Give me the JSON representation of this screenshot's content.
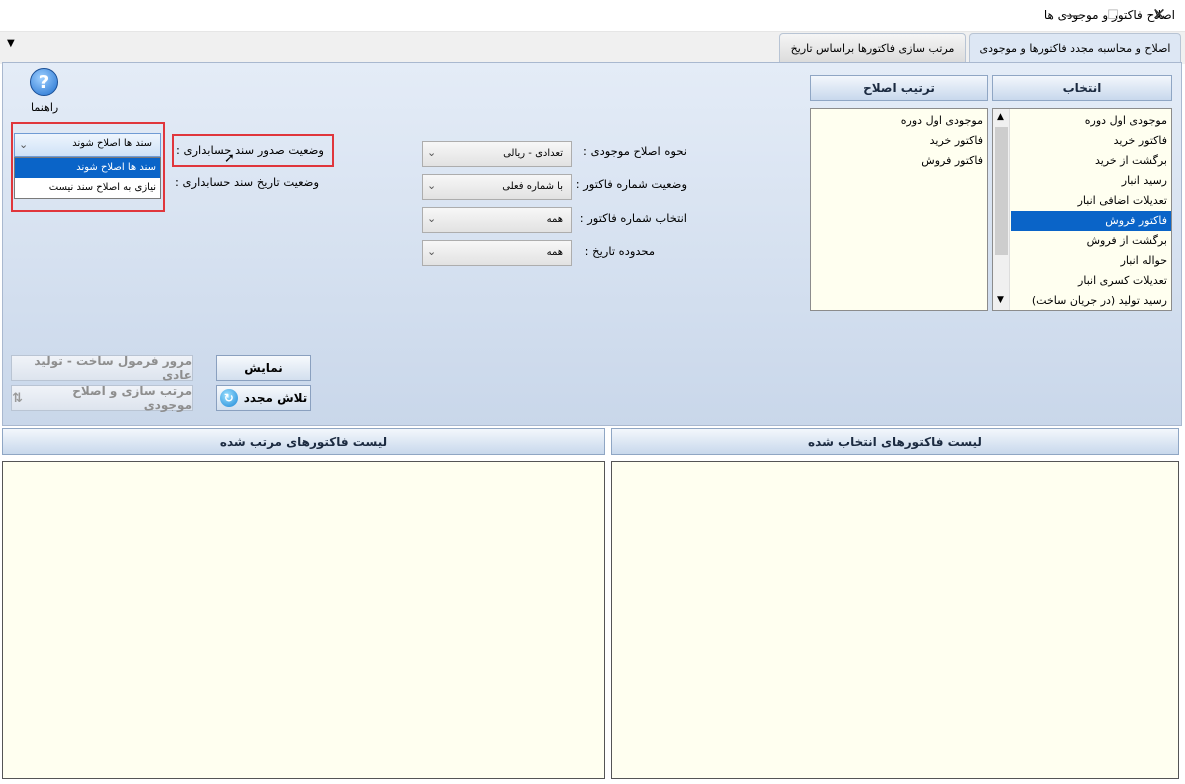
{
  "window": {
    "title": "اصلاح فاکتور و موجودی ها",
    "minimize_icon": "minimize-icon",
    "maximize_icon": "maximize-icon",
    "close_icon": "close-icon"
  },
  "tabs": [
    {
      "label": "اصلاح و محاسبه مجدد فاکتورها و موجودی",
      "active": true
    },
    {
      "label": "مرتب سازی فاکتورها براساس تاریخ",
      "active": false
    }
  ],
  "help": {
    "label": "راهنما"
  },
  "selection": {
    "header": "انتخاب",
    "items": [
      "موجودی اول دوره",
      "فاکتور خرید",
      "برگشت از خرید",
      "رسید انبار",
      "تعدیلات اضافی انبار",
      "فاکتور فروش",
      "برگشت از فروش",
      "حواله انبار",
      "تعدیلات کسری انبار",
      "رسید تولید (در جریان ساخت)"
    ],
    "selected": "فاکتور فروش"
  },
  "order": {
    "header": "ترتیب اصلاح",
    "items": [
      "موجودی اول دوره",
      "فاکتور خرید",
      "فاکتور فروش"
    ]
  },
  "fields": {
    "inventory_method": {
      "label": "نحوه اصلاح موجودی :",
      "value": "تعدادی - ریالی"
    },
    "invoice_number_status": {
      "label": "وضعیت شماره فاکتور :",
      "value": "با شماره فعلی"
    },
    "invoice_number_select": {
      "label": "انتخاب شماره فاکتور :",
      "value": "همه"
    },
    "date_range": {
      "label": "محدوده تاریخ :",
      "value": "همه"
    },
    "doc_issue_status": {
      "label": "وضعیت صدور سند حسابداری :",
      "value": "سند ها اصلاح شوند"
    },
    "doc_date_status": {
      "label": "وضعیت تاریخ سند حسابداری :"
    }
  },
  "dropdown_options": [
    "سند ها اصلاح شوند",
    "نیازی به اصلاح سند نیست"
  ],
  "buttons": {
    "show": "نمایش",
    "retry": "تلاش مجدد",
    "formula_review": "مرور فرمول ساخت - تولید عادی",
    "sort_fix": "مرتب سازی و اصلاح موجودی"
  },
  "lists": {
    "selected_invoices": "لیست فاکتورهای انتخاب شده",
    "sorted_invoices": "لیست فاکتورهای مرتب شده"
  },
  "colors": {
    "selection": "#0a64c8",
    "highlight_border": "#e0363c",
    "list_bg": "#fffff0"
  }
}
